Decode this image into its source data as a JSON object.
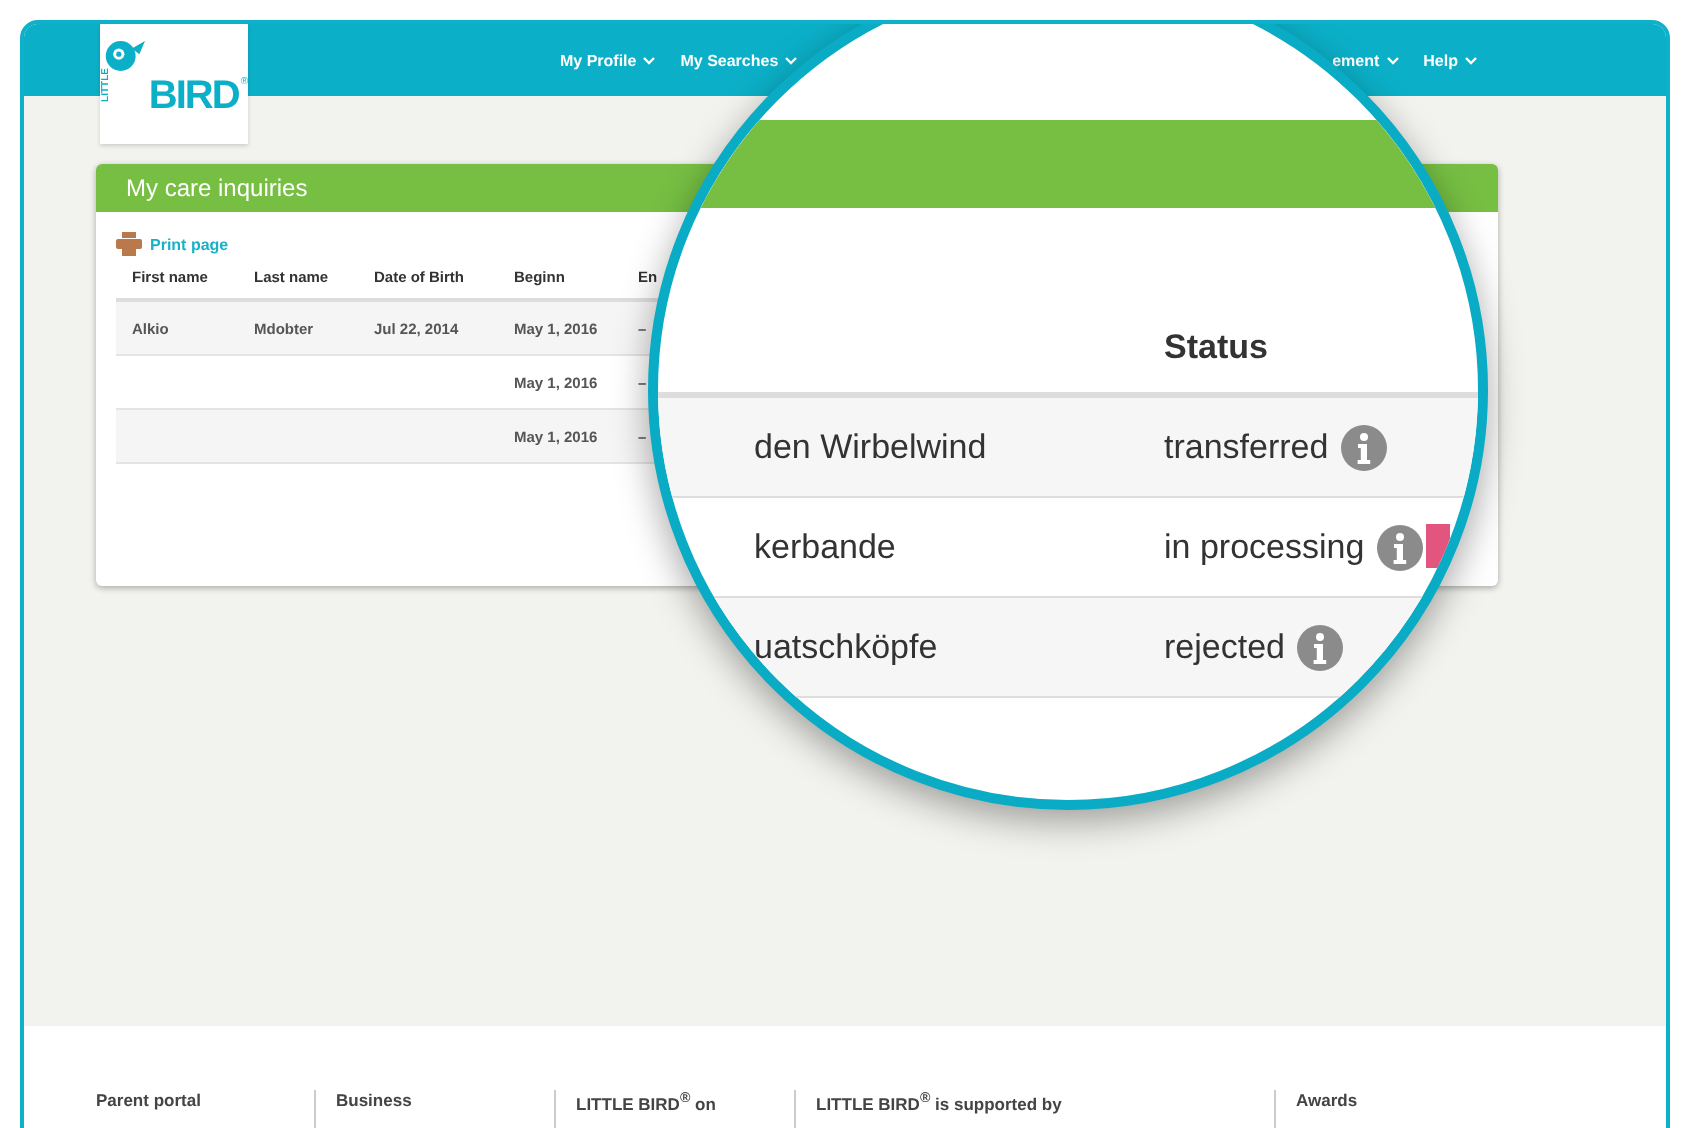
{
  "header": {
    "logo": {
      "small": "LITTLE",
      "big": "BIRD",
      "mark": "®"
    },
    "nav_left": [
      {
        "label": "My Profile"
      },
      {
        "label": "My Searches"
      }
    ],
    "nav_right": [
      {
        "label": "ement"
      },
      {
        "label": "Help"
      }
    ]
  },
  "card": {
    "title": "My care inquiries",
    "print_link": "Print page",
    "columns": [
      "First name",
      "Last name",
      "Date of Birth",
      "Beginn",
      "En"
    ],
    "rows": [
      {
        "first_name": "Alkio",
        "last_name": "Mdobter",
        "date_of_birth": "Jul 22, 2014",
        "begin": "May 1, 2016",
        "end": "–"
      },
      {
        "begin": "May 1, 2016",
        "end": "–"
      },
      {
        "begin": "May 1, 2016",
        "end": "–"
      }
    ]
  },
  "magnifier": {
    "status_heading": "Status",
    "rows": [
      {
        "name": "den Wirbelwind",
        "status": "transferred"
      },
      {
        "name": "kerbande",
        "status": "in processing",
        "tag": {
          "color": "#e2557f"
        }
      },
      {
        "name": "uatschköpfe",
        "status": "rejected"
      }
    ]
  },
  "footer": {
    "columns": [
      "Parent portal",
      "Business",
      "LITTLE BIRD$^{®}$ on",
      "LITTLE BIRD$^{®}$ is supported by",
      "Awards"
    ]
  }
}
